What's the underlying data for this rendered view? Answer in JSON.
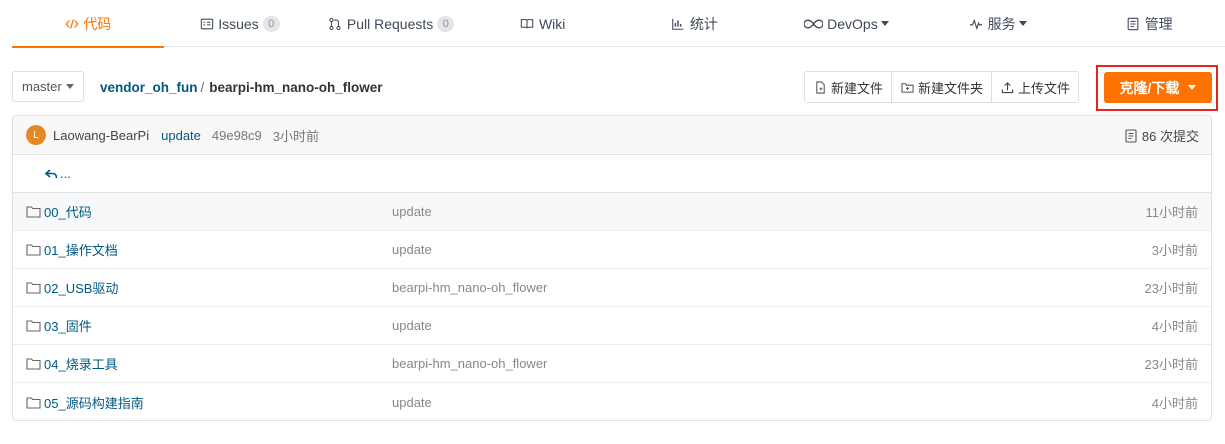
{
  "tabs": [
    {
      "label": "代码",
      "icon": "code-icon",
      "active": true
    },
    {
      "label": "Issues",
      "icon": "issues-icon",
      "count": "0"
    },
    {
      "label": "Pull Requests",
      "icon": "pull-request-icon",
      "count": "0"
    },
    {
      "label": "Wiki",
      "icon": "wiki-icon"
    },
    {
      "label": "统计",
      "icon": "stats-icon"
    },
    {
      "label": "DevOps",
      "icon": "devops-icon",
      "dropdown": true
    },
    {
      "label": "服务",
      "icon": "service-icon",
      "dropdown": true
    },
    {
      "label": "管理",
      "icon": "manage-icon"
    }
  ],
  "toolbar": {
    "branch": "master",
    "breadcrumb_root": "vendor_oh_fun",
    "breadcrumb_sep": "/",
    "breadcrumb_current": "bearpi-hm_nano-oh_flower",
    "new_file": "新建文件",
    "new_folder": "新建文件夹",
    "upload": "上传文件",
    "clone": "克隆/下载"
  },
  "commit": {
    "avatar_letter": "L",
    "author": "Laowang-BearPi",
    "message": "update",
    "hash": "49e98c9",
    "time": "3小时前",
    "count": "86 次提交"
  },
  "back_label": "...",
  "files": [
    {
      "name": "00_代码",
      "message": "update",
      "time": "11小时前"
    },
    {
      "name": "01_操作文档",
      "message": "update",
      "time": "3小时前"
    },
    {
      "name": "02_USB驱动",
      "message": "bearpi-hm_nano-oh_flower",
      "time": "23小时前"
    },
    {
      "name": "03_固件",
      "message": "update",
      "time": "4小时前"
    },
    {
      "name": "04_烧录工具",
      "message": "bearpi-hm_nano-oh_flower",
      "time": "23小时前"
    },
    {
      "name": "05_源码构建指南",
      "message": "update",
      "time": "4小时前"
    }
  ],
  "colors": {
    "accent": "#fe7300",
    "highlight_border": "#e8231c",
    "link": "#005980"
  }
}
